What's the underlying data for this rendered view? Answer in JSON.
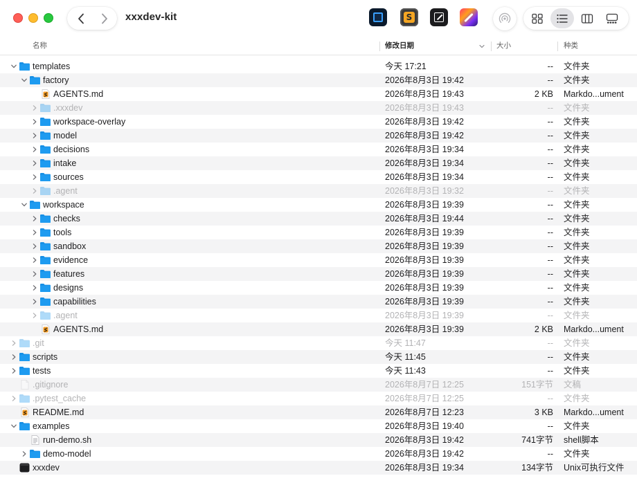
{
  "window": {
    "title": "xxxdev-kit"
  },
  "toolbar": {
    "back_icon": "chevron-left-icon",
    "forward_icon": "chevron-right-icon",
    "apps": [
      "terminal-app-icon",
      "sublime-text-app-icon",
      "text-editor-app-icon",
      "color-app-icon"
    ],
    "airdrop_icon": "airdrop-icon",
    "views": [
      "icon-view",
      "list-view",
      "column-view",
      "gallery-view"
    ],
    "active_view": "list-view"
  },
  "header": {
    "name": "名称",
    "date": "修改日期",
    "size": "大小",
    "kind": "种类",
    "sort_indicator": "chevron-down-icon"
  },
  "colors": {
    "folder": "#1e9bf0",
    "selected_view_bg": "#e3e3e6",
    "zebra": "#f4f4f5",
    "hidden_text": "#b3b3b5"
  },
  "rows": [
    {
      "name": "templates",
      "date": "今天 17:21",
      "size": "--",
      "kind": "文件夹",
      "level": 0,
      "type": "folder",
      "disclosure": "open",
      "hidden": false
    },
    {
      "name": "factory",
      "date": "2026年8月3日 19:42",
      "size": "--",
      "kind": "文件夹",
      "level": 1,
      "type": "folder",
      "disclosure": "open",
      "hidden": false
    },
    {
      "name": "AGENTS.md",
      "date": "2026年8月3日 19:43",
      "size": "2 KB",
      "kind": "Markdo...ument",
      "level": 2,
      "type": "markdown",
      "disclosure": "none",
      "hidden": false
    },
    {
      "name": ".xxxdev",
      "date": "2026年8月3日 19:43",
      "size": "--",
      "kind": "文件夹",
      "level": 2,
      "type": "folder",
      "disclosure": "closed",
      "hidden": true
    },
    {
      "name": "workspace-overlay",
      "date": "2026年8月3日 19:42",
      "size": "--",
      "kind": "文件夹",
      "level": 2,
      "type": "folder",
      "disclosure": "closed",
      "hidden": false
    },
    {
      "name": "model",
      "date": "2026年8月3日 19:42",
      "size": "--",
      "kind": "文件夹",
      "level": 2,
      "type": "folder",
      "disclosure": "closed",
      "hidden": false
    },
    {
      "name": "decisions",
      "date": "2026年8月3日 19:34",
      "size": "--",
      "kind": "文件夹",
      "level": 2,
      "type": "folder",
      "disclosure": "closed",
      "hidden": false
    },
    {
      "name": "intake",
      "date": "2026年8月3日 19:34",
      "size": "--",
      "kind": "文件夹",
      "level": 2,
      "type": "folder",
      "disclosure": "closed",
      "hidden": false
    },
    {
      "name": "sources",
      "date": "2026年8月3日 19:34",
      "size": "--",
      "kind": "文件夹",
      "level": 2,
      "type": "folder",
      "disclosure": "closed",
      "hidden": false
    },
    {
      "name": ".agent",
      "date": "2026年8月3日 19:32",
      "size": "--",
      "kind": "文件夹",
      "level": 2,
      "type": "folder",
      "disclosure": "closed",
      "hidden": true
    },
    {
      "name": "workspace",
      "date": "2026年8月3日 19:39",
      "size": "--",
      "kind": "文件夹",
      "level": 1,
      "type": "folder",
      "disclosure": "open",
      "hidden": false
    },
    {
      "name": "checks",
      "date": "2026年8月3日 19:44",
      "size": "--",
      "kind": "文件夹",
      "level": 2,
      "type": "folder",
      "disclosure": "closed",
      "hidden": false
    },
    {
      "name": "tools",
      "date": "2026年8月3日 19:39",
      "size": "--",
      "kind": "文件夹",
      "level": 2,
      "type": "folder",
      "disclosure": "closed",
      "hidden": false
    },
    {
      "name": "sandbox",
      "date": "2026年8月3日 19:39",
      "size": "--",
      "kind": "文件夹",
      "level": 2,
      "type": "folder",
      "disclosure": "closed",
      "hidden": false
    },
    {
      "name": "evidence",
      "date": "2026年8月3日 19:39",
      "size": "--",
      "kind": "文件夹",
      "level": 2,
      "type": "folder",
      "disclosure": "closed",
      "hidden": false
    },
    {
      "name": "features",
      "date": "2026年8月3日 19:39",
      "size": "--",
      "kind": "文件夹",
      "level": 2,
      "type": "folder",
      "disclosure": "closed",
      "hidden": false
    },
    {
      "name": "designs",
      "date": "2026年8月3日 19:39",
      "size": "--",
      "kind": "文件夹",
      "level": 2,
      "type": "folder",
      "disclosure": "closed",
      "hidden": false
    },
    {
      "name": "capabilities",
      "date": "2026年8月3日 19:39",
      "size": "--",
      "kind": "文件夹",
      "level": 2,
      "type": "folder",
      "disclosure": "closed",
      "hidden": false
    },
    {
      "name": ".agent",
      "date": "2026年8月3日 19:39",
      "size": "--",
      "kind": "文件夹",
      "level": 2,
      "type": "folder",
      "disclosure": "closed",
      "hidden": true
    },
    {
      "name": "AGENTS.md",
      "date": "2026年8月3日 19:39",
      "size": "2 KB",
      "kind": "Markdo...ument",
      "level": 2,
      "type": "markdown",
      "disclosure": "none",
      "hidden": false
    },
    {
      "name": ".git",
      "date": "今天 11:47",
      "size": "--",
      "kind": "文件夹",
      "level": 0,
      "type": "folder",
      "disclosure": "closed",
      "hidden": true
    },
    {
      "name": "scripts",
      "date": "今天 11:45",
      "size": "--",
      "kind": "文件夹",
      "level": 0,
      "type": "folder",
      "disclosure": "closed",
      "hidden": false
    },
    {
      "name": "tests",
      "date": "今天 11:43",
      "size": "--",
      "kind": "文件夹",
      "level": 0,
      "type": "folder",
      "disclosure": "closed",
      "hidden": false
    },
    {
      "name": ".gitignore",
      "date": "2026年8月7日 12:25",
      "size": "151字节",
      "kind": "文稿",
      "level": 0,
      "type": "document",
      "disclosure": "none",
      "hidden": true
    },
    {
      "name": ".pytest_cache",
      "date": "2026年8月7日 12:25",
      "size": "--",
      "kind": "文件夹",
      "level": 0,
      "type": "folder",
      "disclosure": "closed",
      "hidden": true
    },
    {
      "name": "README.md",
      "date": "2026年8月7日 12:23",
      "size": "3 KB",
      "kind": "Markdo...ument",
      "level": 0,
      "type": "markdown",
      "disclosure": "none",
      "hidden": false
    },
    {
      "name": "examples",
      "date": "2026年8月3日 19:40",
      "size": "--",
      "kind": "文件夹",
      "level": 0,
      "type": "folder",
      "disclosure": "open",
      "hidden": false
    },
    {
      "name": "run-demo.sh",
      "date": "2026年8月3日 19:42",
      "size": "741字节",
      "kind": "shell脚本",
      "level": 1,
      "type": "script",
      "disclosure": "none",
      "hidden": false
    },
    {
      "name": "demo-model",
      "date": "2026年8月3日 19:42",
      "size": "--",
      "kind": "文件夹",
      "level": 1,
      "type": "folder",
      "disclosure": "closed",
      "hidden": false
    },
    {
      "name": "xxxdev",
      "date": "2026年8月3日 19:34",
      "size": "134字节",
      "kind": "Unix可执行文件",
      "level": 0,
      "type": "executable",
      "disclosure": "none",
      "hidden": false
    }
  ]
}
